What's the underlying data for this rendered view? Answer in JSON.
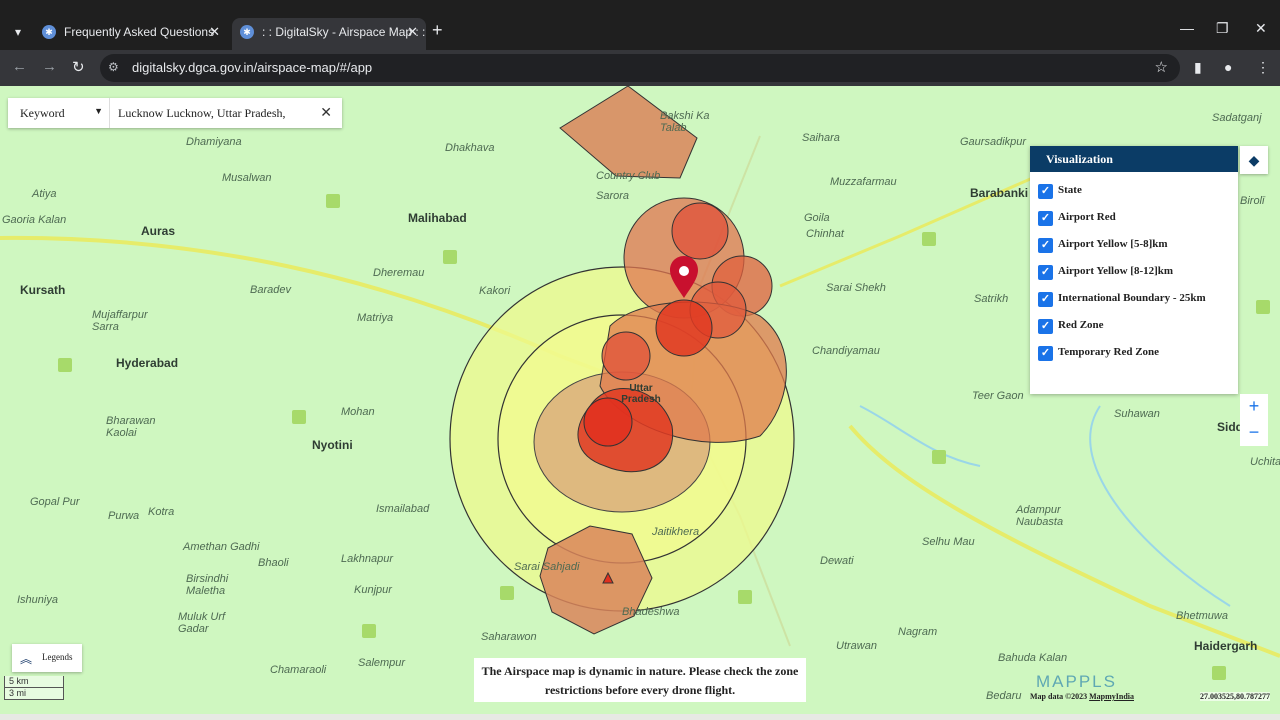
{
  "browser": {
    "tabs": [
      {
        "title": "Frequently Asked Questions"
      },
      {
        "title": ": : DigitalSky - Airspace Map : :"
      }
    ],
    "url": "digitalsky.dgca.gov.in/airspace-map/#/app"
  },
  "search": {
    "type_label": "Keyword",
    "value": "Lucknow Lucknow, Uttar Pradesh,"
  },
  "visualization": {
    "title": "Visualization",
    "items": [
      {
        "label": "State",
        "checked": true
      },
      {
        "label": "Airport Red",
        "checked": true
      },
      {
        "label": "Airport Yellow [5-8]km",
        "checked": true
      },
      {
        "label": "Airport Yellow [8-12]km",
        "checked": true
      },
      {
        "label": "International Boundary - 25km",
        "checked": true
      },
      {
        "label": "Red Zone",
        "checked": true
      },
      {
        "label": "Temporary Red Zone",
        "checked": true
      }
    ]
  },
  "map": {
    "places": [
      {
        "name": "Dhamiyana",
        "big": false
      },
      {
        "name": "Musalwan",
        "big": false
      },
      {
        "name": "Atiya",
        "big": false
      },
      {
        "name": "Gaoria Kalan",
        "big": false
      },
      {
        "name": "Auras",
        "big": true
      },
      {
        "name": "Kursath",
        "big": true
      },
      {
        "name": "Mujaffarpur Sarra",
        "big": false
      },
      {
        "name": "Baradev",
        "big": false
      },
      {
        "name": "Hyderabad",
        "big": true
      },
      {
        "name": "Malihabad",
        "big": true
      },
      {
        "name": "Dheremau",
        "big": false
      },
      {
        "name": "Dhakhava",
        "big": false
      },
      {
        "name": "Kakori",
        "big": false
      },
      {
        "name": "Matriya",
        "big": false
      },
      {
        "name": "Mohan",
        "big": false
      },
      {
        "name": "Nyotini",
        "big": true
      },
      {
        "name": "Bharawan Kaolai",
        "big": false
      },
      {
        "name": "Gopal Pur",
        "big": false
      },
      {
        "name": "Purwa",
        "big": false
      },
      {
        "name": "Kotra",
        "big": false
      },
      {
        "name": "Ismailabad",
        "big": false
      },
      {
        "name": "Amethan Gadhi",
        "big": false
      },
      {
        "name": "Bhaoli",
        "big": false
      },
      {
        "name": "Lakhnapur",
        "big": false
      },
      {
        "name": "Birsindhi Maletha",
        "big": false
      },
      {
        "name": "Ishuniya",
        "big": false
      },
      {
        "name": "Muluk Urf Gadar",
        "big": false
      },
      {
        "name": "Kunjpur",
        "big": false
      },
      {
        "name": "Saharawon",
        "big": false
      },
      {
        "name": "Chamaraoli",
        "big": false
      },
      {
        "name": "Salempur",
        "big": false
      },
      {
        "name": "Sarai Sahjadi",
        "big": false
      },
      {
        "name": "Bhadeshwa",
        "big": false
      },
      {
        "name": "Jaitikhera",
        "big": false
      },
      {
        "name": "Dewati",
        "big": false
      },
      {
        "name": "Utrawan",
        "big": false
      },
      {
        "name": "Nagram",
        "big": false
      },
      {
        "name": "Bahuda Kalan",
        "big": false
      },
      {
        "name": "Bedaru",
        "big": false
      },
      {
        "name": "Saihara",
        "big": false
      },
      {
        "name": "Muzzafarmau",
        "big": false
      },
      {
        "name": "Goila",
        "big": false
      },
      {
        "name": "Chinhat",
        "big": false
      },
      {
        "name": "Sarai Shekh",
        "big": false
      },
      {
        "name": "Chandiyamau",
        "big": false
      },
      {
        "name": "Satrikh",
        "big": false
      },
      {
        "name": "Barabanki",
        "big": true
      },
      {
        "name": "Gaursadikpur",
        "big": false
      },
      {
        "name": "Teer Gaon",
        "big": false
      },
      {
        "name": "Suhawan",
        "big": false
      },
      {
        "name": "Adampur Naubasta",
        "big": false
      },
      {
        "name": "Selhu Mau",
        "big": false
      },
      {
        "name": "Haidergarh",
        "big": true
      },
      {
        "name": "Bhetmuwa",
        "big": false
      },
      {
        "name": "Bakshi Ka Talab",
        "big": false
      },
      {
        "name": "Country Club",
        "big": false
      },
      {
        "name": "Sarora",
        "big": false
      },
      {
        "name": "Uttar Pradesh",
        "big": true
      },
      {
        "name": "Sadatganj",
        "big": false
      },
      {
        "name": "Birolī",
        "big": false
      },
      {
        "name": "Sidd",
        "big": true
      },
      {
        "name": "Uchita",
        "big": false
      }
    ]
  },
  "legends_label": "Legends",
  "scale": {
    "km": "5 km",
    "mi": "3 mi"
  },
  "notice": "The Airspace map is dynamic in nature. Please check the zone restrictions before every drone flight.",
  "brand": "MAPPLS",
  "attribution": {
    "prefix": "Map data ©2023",
    "link": "MapmyIndia"
  },
  "coords": "27.003525,80.787277",
  "colors": {
    "viz_header": "#0b3c66",
    "map_bg": "#cff7c0",
    "red_zone": "#e0301e",
    "yellow_zone": "#e8f57a"
  }
}
